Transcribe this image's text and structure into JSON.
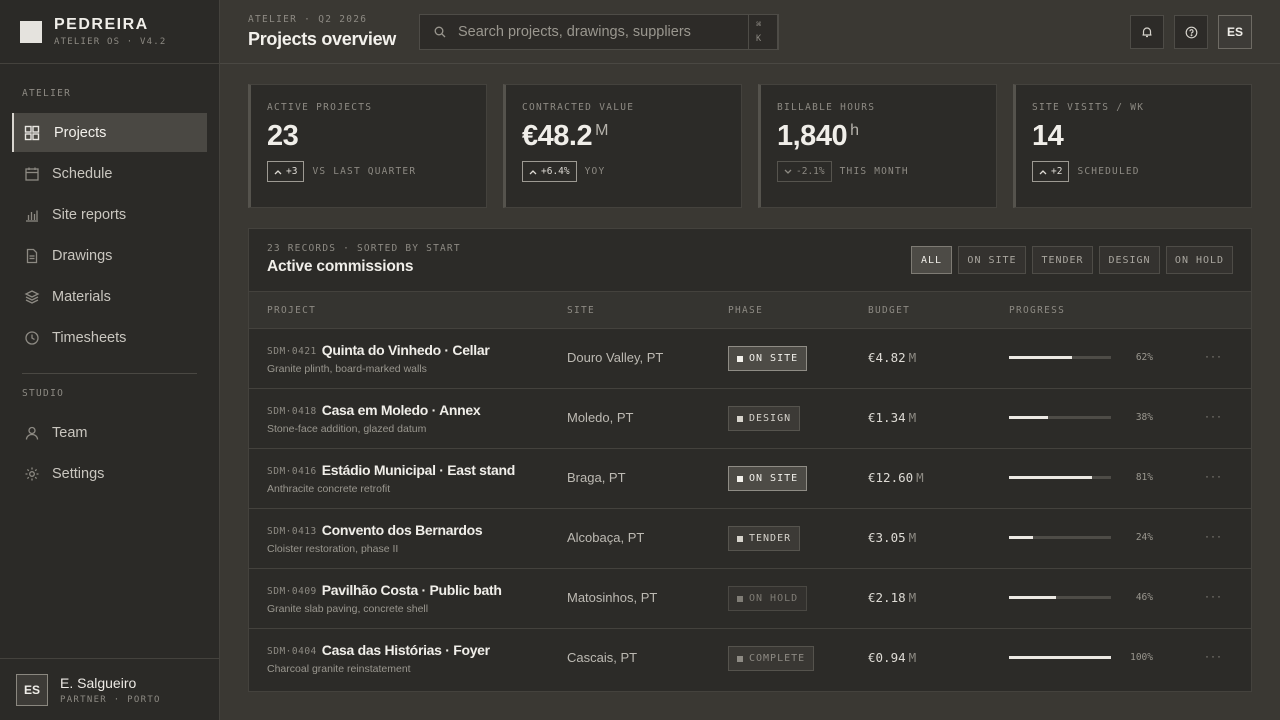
{
  "brand": {
    "name": "PEDREIRA",
    "subtitle": "ATELIER OS · V4.2"
  },
  "sidebar": {
    "section_atelier": "ATELIER",
    "section_studio": "STUDIO",
    "items": [
      {
        "label": "Projects",
        "icon": "grid-icon",
        "active": true
      },
      {
        "label": "Schedule",
        "icon": "calendar-icon"
      },
      {
        "label": "Site reports",
        "icon": "bar-chart-icon"
      },
      {
        "label": "Drawings",
        "icon": "document-icon"
      },
      {
        "label": "Materials",
        "icon": "layers-icon"
      },
      {
        "label": "Timesheets",
        "icon": "clock-icon"
      }
    ],
    "studio_items": [
      {
        "label": "Team",
        "icon": "user-icon"
      },
      {
        "label": "Settings",
        "icon": "gear-icon"
      }
    ],
    "user": {
      "initials": "ES",
      "name": "E. Salgueiro",
      "role": "PARTNER · PORTO"
    }
  },
  "header": {
    "eyebrow": "ATELIER · Q2 2026",
    "title": "Projects overview",
    "search_placeholder": "Search projects, drawings, suppliers",
    "kbd_1": "⌘",
    "kbd_2": "K",
    "user_initials": "ES"
  },
  "kpis": [
    {
      "label": "ACTIVE PROJECTS",
      "value": "23",
      "unit": "",
      "delta": "+3",
      "direction": "up",
      "note": "VS LAST QUARTER"
    },
    {
      "label": "CONTRACTED VALUE",
      "value": "€48.2",
      "unit": "M",
      "delta": "+6.4%",
      "direction": "up",
      "note": "YOY"
    },
    {
      "label": "BILLABLE HOURS",
      "value": "1,840",
      "unit": "h",
      "delta": "-2.1%",
      "direction": "down",
      "note": "THIS MONTH"
    },
    {
      "label": "SITE VISITS / WK",
      "value": "14",
      "unit": "",
      "delta": "+2",
      "direction": "up",
      "note": "SCHEDULED"
    }
  ],
  "table": {
    "meta": "23 RECORDS · SORTED BY START",
    "title": "Active commissions",
    "filters": [
      "ALL",
      "ON SITE",
      "TENDER",
      "DESIGN",
      "ON HOLD"
    ],
    "active_filter": "ALL",
    "columns": [
      "PROJECT",
      "SITE",
      "PHASE",
      "BUDGET",
      "PROGRESS"
    ],
    "rows": [
      {
        "code": "SDM·0421",
        "name": "Quinta do Vinhedo · Cellar",
        "desc": "Granite plinth, board-marked walls",
        "site": "Douro Valley, PT",
        "phase": "ON SITE",
        "phase_kind": "onsite",
        "budget": "€4.82",
        "budget_unit": "M",
        "progress": 62,
        "progress_label": "62%",
        "more": "···"
      },
      {
        "code": "SDM·0418",
        "name": "Casa em Moledo · Annex",
        "desc": "Stone-face addition, glazed datum",
        "site": "Moledo, PT",
        "phase": "DESIGN",
        "phase_kind": "design",
        "budget": "€1.34",
        "budget_unit": "M",
        "progress": 38,
        "progress_label": "38%",
        "more": "···"
      },
      {
        "code": "SDM·0416",
        "name": "Estádio Municipal · East stand",
        "desc": "Anthracite concrete retrofit",
        "site": "Braga, PT",
        "phase": "ON SITE",
        "phase_kind": "onsite",
        "budget": "€12.60",
        "budget_unit": "M",
        "progress": 81,
        "progress_label": "81%",
        "more": "···"
      },
      {
        "code": "SDM·0413",
        "name": "Convento dos Bernardos",
        "desc": "Cloister restoration, phase II",
        "site": "Alcobaça, PT",
        "phase": "TENDER",
        "phase_kind": "tender",
        "budget": "€3.05",
        "budget_unit": "M",
        "progress": 24,
        "progress_label": "24%",
        "more": "···"
      },
      {
        "code": "SDM·0409",
        "name": "Pavilhão Costa · Public bath",
        "desc": "Granite slab paving, concrete shell",
        "site": "Matosinhos, PT",
        "phase": "ON HOLD",
        "phase_kind": "onhold",
        "budget": "€2.18",
        "budget_unit": "M",
        "progress": 46,
        "progress_label": "46%",
        "more": "···"
      },
      {
        "code": "SDM·0404",
        "name": "Casa das Histórias · Foyer",
        "desc": "Charcoal granite reinstatement",
        "site": "Cascais, PT",
        "phase": "COMPLETE",
        "phase_kind": "complete",
        "budget": "€0.94",
        "budget_unit": "M",
        "progress": 100,
        "progress_label": "100%",
        "more": "···"
      }
    ]
  }
}
